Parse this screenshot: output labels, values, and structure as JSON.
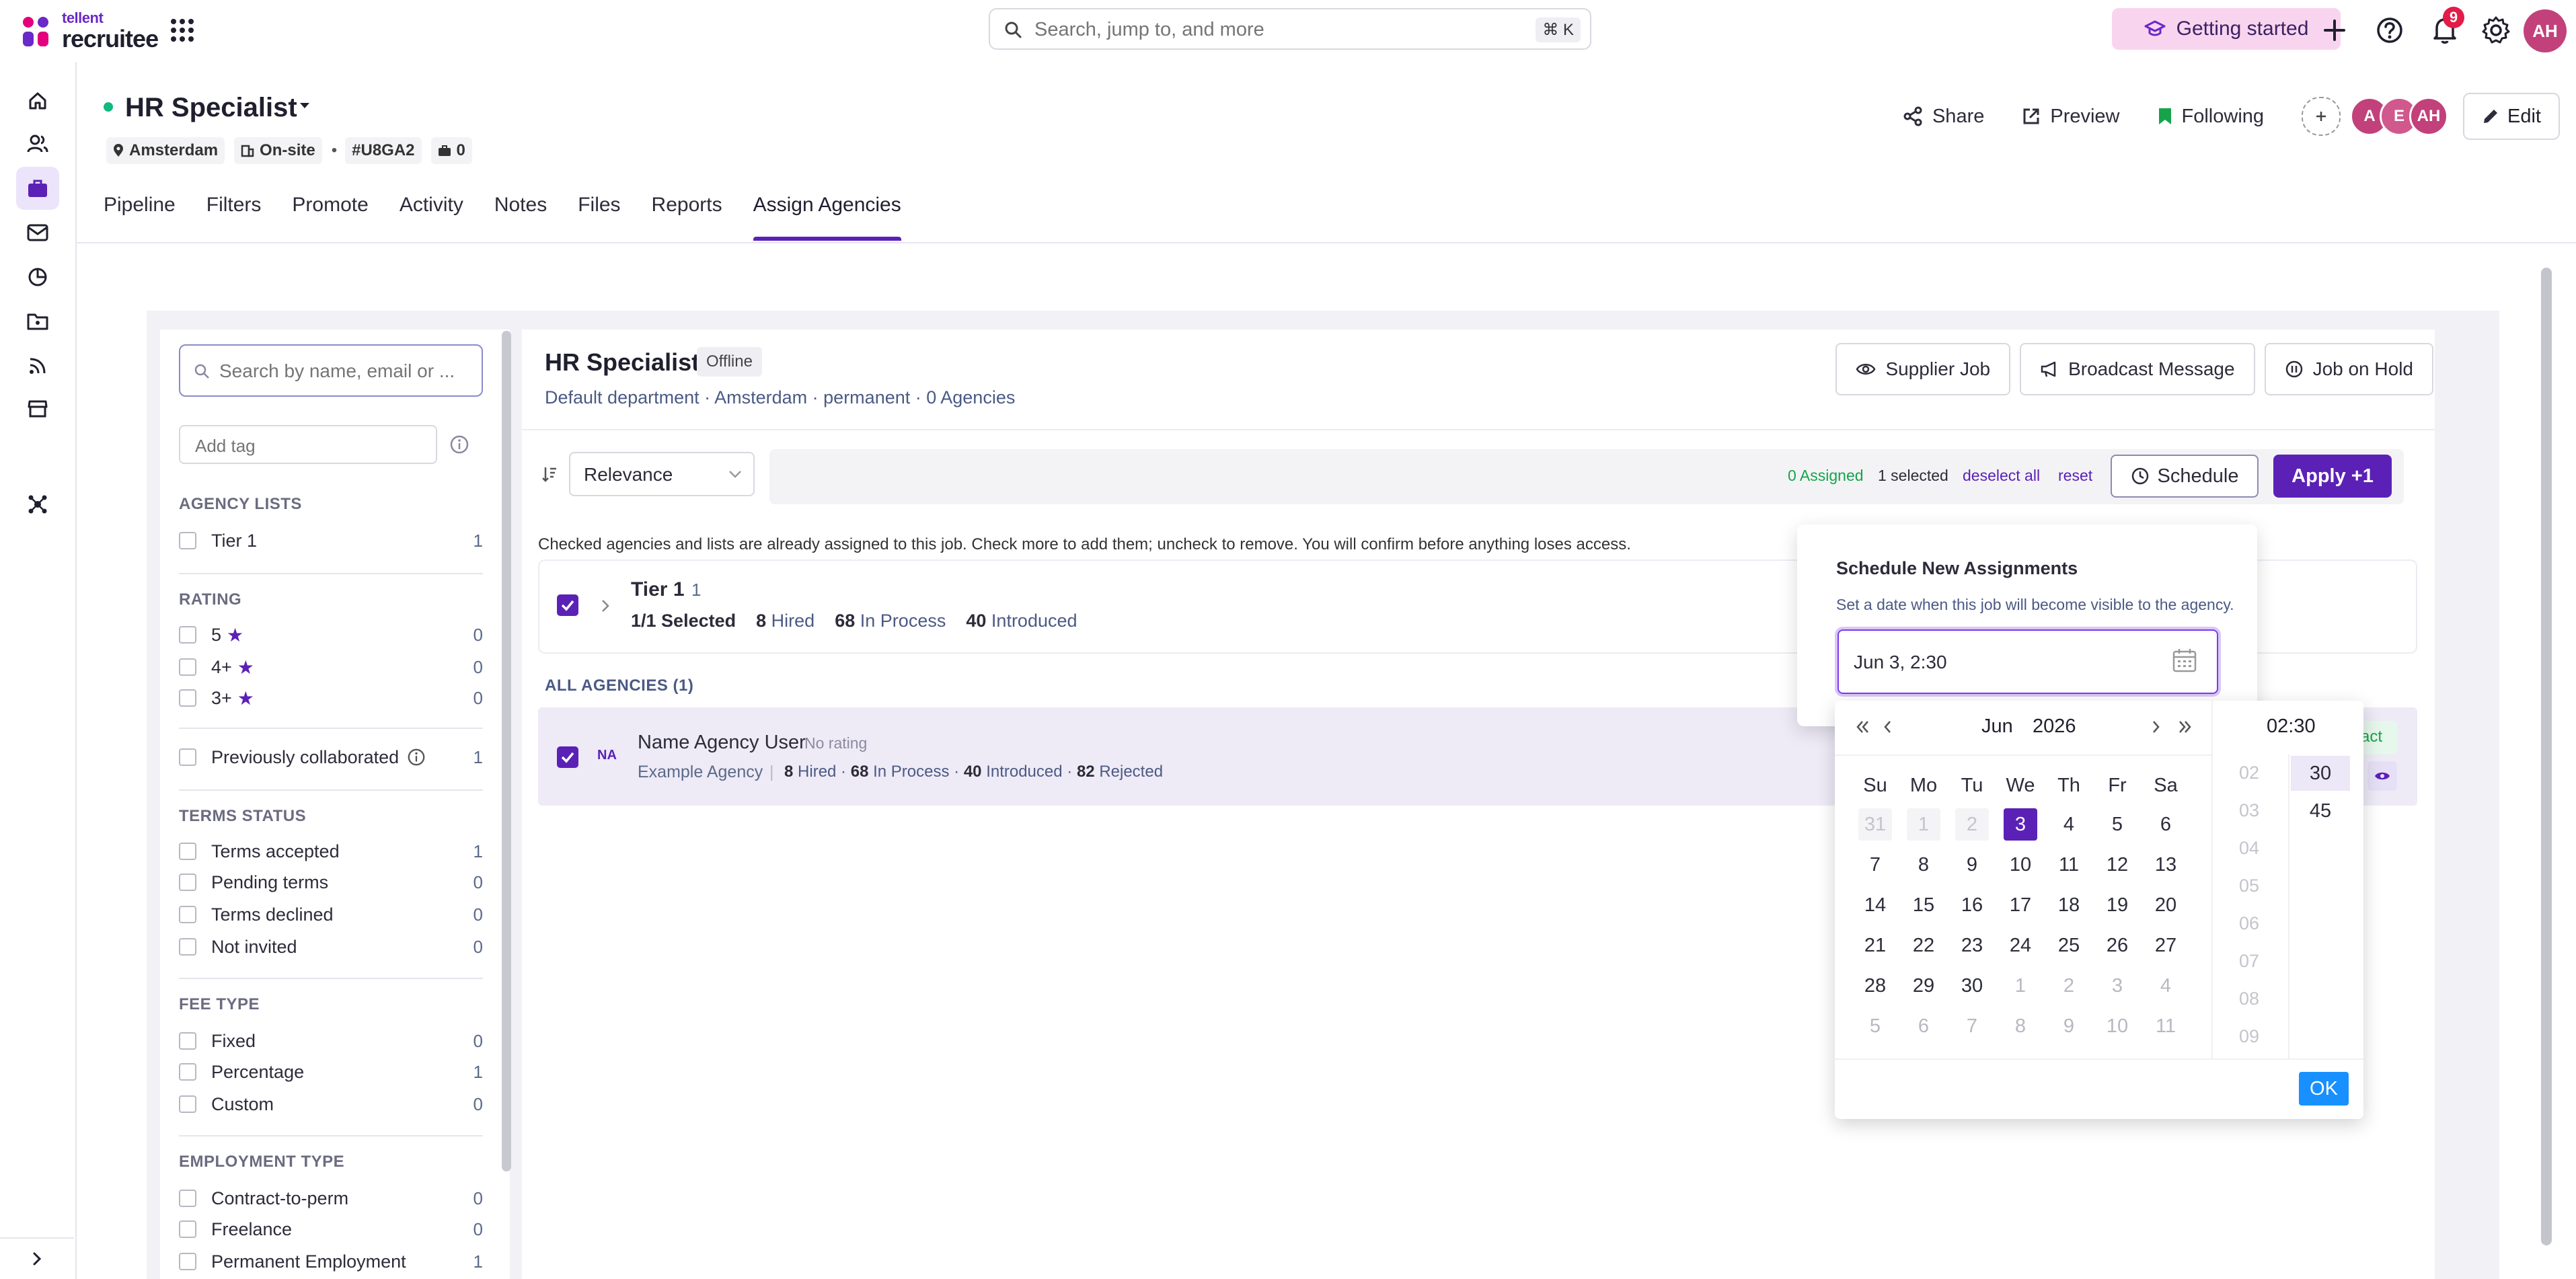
{
  "app": {
    "logo_small": "tellent",
    "logo_name": "recruitee",
    "search_placeholder": "Search, jump to, and more",
    "search_shortcut": "⌘ K",
    "getting_started": "Getting started",
    "notification_count": "9",
    "user_initials": "AH",
    "accent_color": "#5b21b6"
  },
  "job": {
    "title": "HR Specialist",
    "location": "Amsterdam",
    "workplace": "On-site",
    "code": "#U8GA2",
    "openings": "0",
    "tabs": [
      "Pipeline",
      "Filters",
      "Promote",
      "Activity",
      "Notes",
      "Files",
      "Reports",
      "Assign Agencies"
    ],
    "active_tab": "Assign Agencies",
    "actions": {
      "share": "Share",
      "preview": "Preview",
      "following": "Following",
      "edit": "Edit"
    },
    "team_avatars": [
      {
        "initials": "A",
        "color": "#c2417a"
      },
      {
        "initials": "E",
        "color": "#d0588c"
      },
      {
        "initials": "AH",
        "color": "#c2417a"
      }
    ]
  },
  "filters": {
    "search_placeholder": "Search by name, email or ...",
    "tag_placeholder": "Add tag",
    "sections": {
      "agency_lists": {
        "heading": "AGENCY LISTS",
        "items": [
          {
            "label": "Tier 1",
            "count": "1"
          }
        ]
      },
      "rating": {
        "heading": "RATING",
        "items": [
          {
            "label": "5",
            "count": "0"
          },
          {
            "label": "4+",
            "count": "0"
          },
          {
            "label": "3+",
            "count": "0"
          }
        ]
      },
      "previously": {
        "label": "Previously collaborated",
        "count": "1"
      },
      "terms_status": {
        "heading": "TERMS STATUS",
        "items": [
          {
            "label": "Terms accepted",
            "count": "1"
          },
          {
            "label": "Pending terms",
            "count": "0"
          },
          {
            "label": "Terms declined",
            "count": "0"
          },
          {
            "label": "Not invited",
            "count": "0"
          }
        ]
      },
      "fee_type": {
        "heading": "FEE TYPE",
        "items": [
          {
            "label": "Fixed",
            "count": "0"
          },
          {
            "label": "Percentage",
            "count": "1"
          },
          {
            "label": "Custom",
            "count": "0"
          }
        ]
      },
      "employment_type": {
        "heading": "EMPLOYMENT TYPE",
        "items": [
          {
            "label": "Contract-to-perm",
            "count": "0"
          },
          {
            "label": "Freelance",
            "count": "0"
          },
          {
            "label": "Permanent Employment",
            "count": "1"
          }
        ]
      }
    }
  },
  "panel": {
    "title": "HR Specialist",
    "status": "Offline",
    "subtitle": "Default department · Amsterdam · permanent · 0 Agencies",
    "actions": {
      "supplier_job": "Supplier Job",
      "broadcast": "Broadcast Message",
      "on_hold": "Job on Hold"
    },
    "sort_value": "Relevance",
    "assigned": "0 Assigned",
    "selected": "1 selected",
    "deselect_all": "deselect all",
    "reset": "reset",
    "schedule": "Schedule",
    "apply": "Apply +1",
    "info": "Checked agencies and lists are already assigned to this job. Check more to add them; uncheck to remove. You will confirm before anything loses access.",
    "tier": {
      "name": "Tier 1",
      "count": "1",
      "selected_num": "1",
      "selected_rest": "/1 Selected",
      "hired_num": "8",
      "hired_label": "Hired",
      "process_num": "68",
      "process_label": "In Process",
      "introduced_num": "40",
      "introduced_label": "Introduced"
    },
    "all_agencies": "ALL AGENCIES (1)",
    "agency": {
      "initials": "NA",
      "name": "Name Agency User",
      "rating": "No rating",
      "org": "Example Agency",
      "sep": "|",
      "hired": "8",
      "hired_label": "Hired ·",
      "process": "68",
      "process_label": "In Process ·",
      "introduced": "40",
      "introduced_label": "Introduced ·",
      "rejected": "82",
      "rejected_label": "Rejected",
      "tag_partial": "act"
    }
  },
  "schedule": {
    "title": "Schedule New Assignments",
    "subtitle": "Set a date when this job will become visible to the agency.",
    "value": "Jun 3, 2:30",
    "picker": {
      "month": "Jun",
      "year": "2026",
      "time": "02:30",
      "weekdays": [
        "Su",
        "Mo",
        "Tu",
        "We",
        "Th",
        "Fr",
        "Sa"
      ],
      "weeks": [
        [
          "31",
          "1",
          "2",
          "3",
          "4",
          "5",
          "6"
        ],
        [
          "7",
          "8",
          "9",
          "10",
          "11",
          "12",
          "13"
        ],
        [
          "14",
          "15",
          "16",
          "17",
          "18",
          "19",
          "20"
        ],
        [
          "21",
          "22",
          "23",
          "24",
          "25",
          "26",
          "27"
        ],
        [
          "28",
          "29",
          "30",
          "1",
          "2",
          "3",
          "4"
        ],
        [
          "5",
          "6",
          "7",
          "8",
          "9",
          "10",
          "11"
        ]
      ],
      "selected_day": "3",
      "hours": [
        "02",
        "03",
        "04",
        "05",
        "06",
        "07",
        "08",
        "09"
      ],
      "minutes": [
        "30",
        "45"
      ],
      "ok": "OK"
    }
  }
}
